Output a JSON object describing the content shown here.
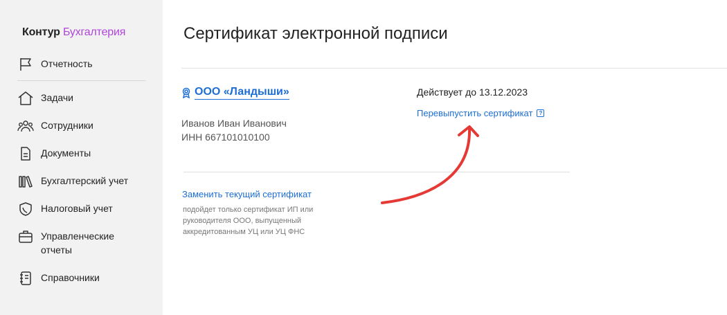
{
  "sidebar": {
    "logo": {
      "brand": "Контур",
      "product": "Бухгалтерия"
    },
    "items": [
      {
        "label": "Отчетность",
        "icon": "flag-icon"
      },
      {
        "label": "Задачи",
        "icon": "home-icon"
      },
      {
        "label": "Сотрудники",
        "icon": "people-icon"
      },
      {
        "label": "Документы",
        "icon": "document-icon"
      },
      {
        "label": "Бухгалтерский учет",
        "icon": "books-icon"
      },
      {
        "label": "Налоговый учет",
        "icon": "shield-icon"
      },
      {
        "label": "Управленческие отчеты",
        "icon": "briefcase-icon"
      },
      {
        "label": "Справочники",
        "icon": "notebook-icon"
      }
    ]
  },
  "main": {
    "title": "Сертификат электронной подписи",
    "organization": {
      "name": "ООО «Ландыши»",
      "icon": "badge-icon",
      "person": "Иванов Иван Иванович",
      "inn": "ИНН 667101010100"
    },
    "certificate": {
      "valid_until": "Действует до 13.12.2023",
      "reissue_label": "Перевыпустить сертификат",
      "help_label": "?"
    },
    "replace": {
      "link_label": "Заменить текущий сертификат",
      "note": "подойдет только сертификат ИП или руководителя ООО, выпущенный аккредитованным УЦ или УЦ ФНС"
    }
  },
  "colors": {
    "sidebar_bg": "#f2f2f2",
    "brand_accent": "#b046d9",
    "link": "#1c6ed4",
    "annotation_arrow": "#e53935"
  }
}
